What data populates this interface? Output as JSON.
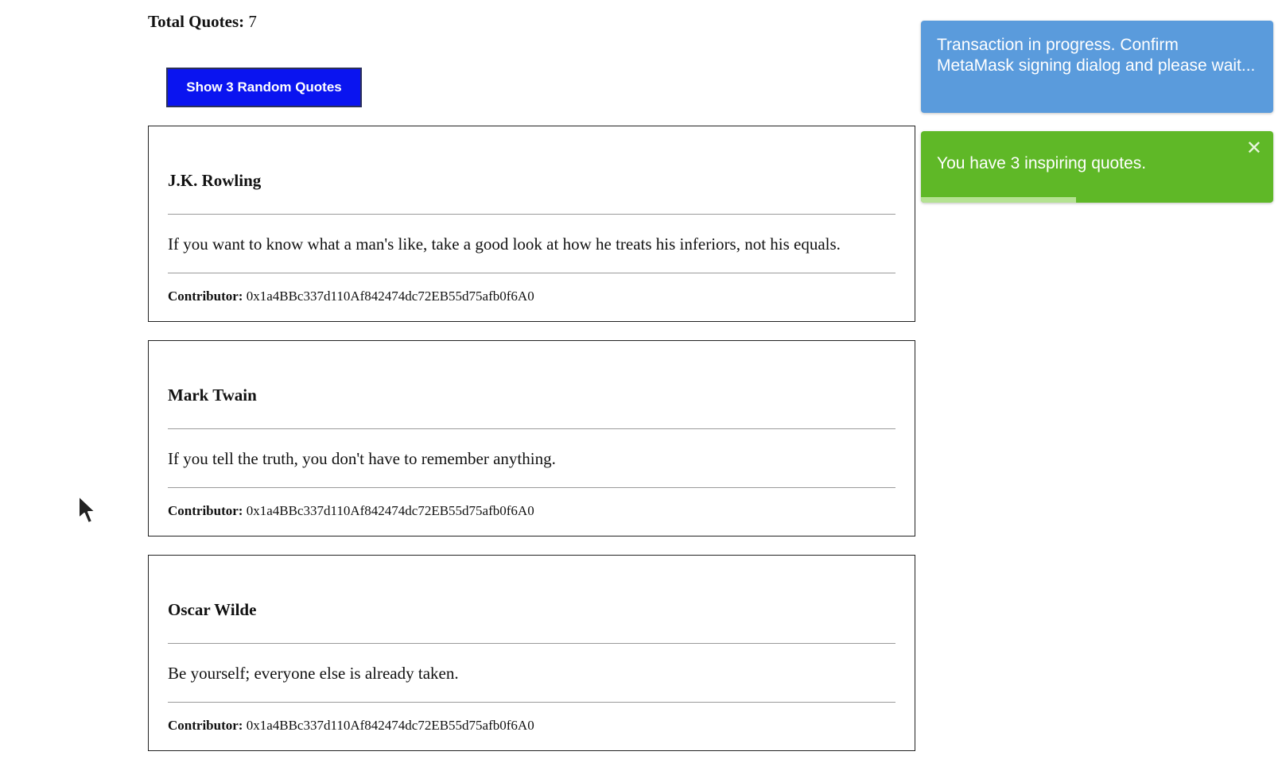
{
  "header": {
    "total_label": "Total Quotes:",
    "total_value": "7"
  },
  "actions": {
    "show_random_label": "Show 3 Random Quotes"
  },
  "quotes": [
    {
      "author": "J.K. Rowling",
      "text": "If you want to know what a man's like, take a good look at how he treats his inferiors, not his equals.",
      "contributor_label": "Contributor:",
      "contributor": "0x1a4BBc337d110Af842474dc72EB55d75afb0f6A0"
    },
    {
      "author": "Mark Twain",
      "text": "If you tell the truth, you don't have to remember anything.",
      "contributor_label": "Contributor:",
      "contributor": "0x1a4BBc337d110Af842474dc72EB55d75afb0f6A0"
    },
    {
      "author": "Oscar Wilde",
      "text": "Be yourself; everyone else is already taken.",
      "contributor_label": "Contributor:",
      "contributor": "0x1a4BBc337d110Af842474dc72EB55d75afb0f6A0"
    }
  ],
  "toasts": {
    "info": {
      "message": "Transaction in progress. Confirm MetaMask signing dialog and please wait...",
      "color": "#5a9bdc"
    },
    "success": {
      "message": "You have 3 inspiring quotes.",
      "close_icon": "close-icon",
      "color": "#5fb827",
      "progress_fraction": 0.44
    }
  },
  "colors": {
    "button_bg": "#0a14f0",
    "button_text": "#ffffff"
  }
}
